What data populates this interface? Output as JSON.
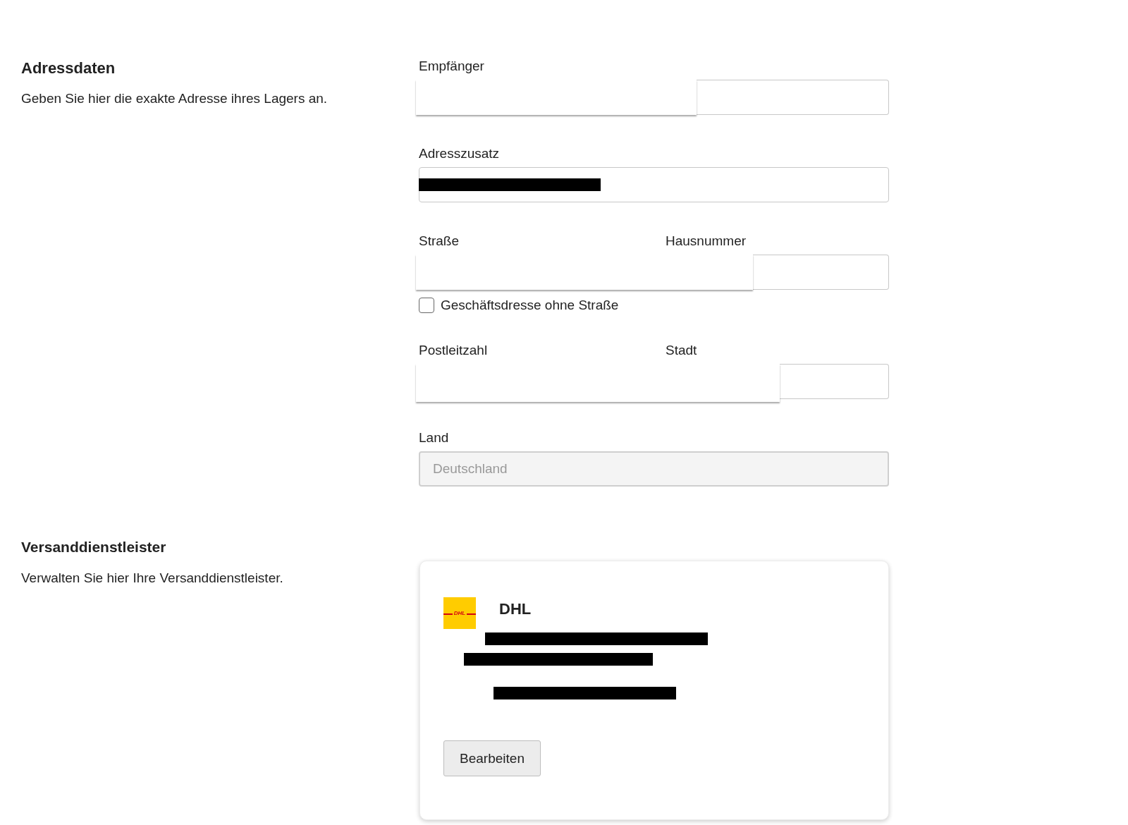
{
  "sections": [
    {
      "kind": "address",
      "title": "Adressdaten",
      "description": "Geben Sie hier die exakte Adresse ihres Lagers an.",
      "rows": [
        {
          "kind": "fields",
          "covered": true,
          "fields": [
            {
              "label": "Empfänger"
            }
          ]
        },
        {
          "kind": "fields",
          "covered": false,
          "fields": [
            {
              "label": "Adresszusatz",
              "kind": "redacted",
              "disabled": false
            }
          ]
        },
        {
          "kind": "fields",
          "covered": true,
          "fields": [
            {
              "label": "Straße"
            },
            {
              "label": "Hausnummer"
            }
          ]
        },
        {
          "kind": "checkbox",
          "label": "Geschäftsdresse ohne Straße",
          "checked": false
        },
        {
          "kind": "fields",
          "covered": true,
          "fields": [
            {
              "label": "Postleitzahl"
            },
            {
              "label": "Stadt"
            }
          ]
        },
        {
          "kind": "fields",
          "covered": false,
          "fields": [
            {
              "label": "Land",
              "kind": "text",
              "value": "Deutschland",
              "disabled": true
            }
          ]
        }
      ]
    },
    {
      "kind": "carriers",
      "title": "Versanddienstleister",
      "description": "Verwalten Sie hier Ihre Versanddienstleister.",
      "carriers": [
        {
          "name": "DHL",
          "logo_text": "DHL",
          "details": [
            {
              "kind": "redacted"
            },
            {
              "kind": "redacted"
            },
            {
              "kind": "redacted"
            }
          ],
          "button": "Bearbeiten"
        }
      ]
    }
  ]
}
